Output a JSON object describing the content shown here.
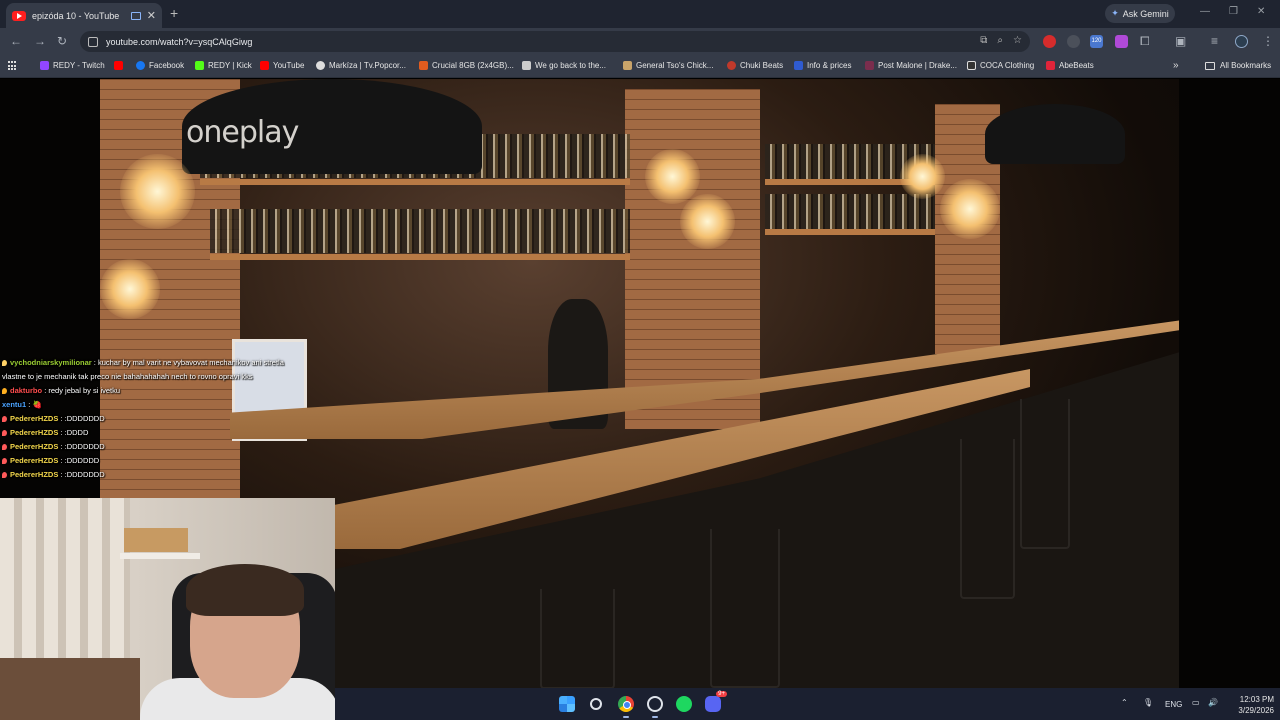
{
  "browser": {
    "tab": {
      "title": "epizóda 10 - YouTube"
    },
    "new_tab_icon": "+",
    "ask_gemini": "Ask Gemini",
    "url": "youtube.com/watch?v=ysqCAlqGiwg",
    "ext_badge": "120",
    "bookmarks": [
      {
        "label": "REDY - Twitch",
        "color": "#9146ff"
      },
      {
        "label": "",
        "color": "#ff0000"
      },
      {
        "label": "Facebook",
        "color": "#1877f2"
      },
      {
        "label": "REDY | Kick",
        "color": "#53fc18"
      },
      {
        "label": "YouTube",
        "color": "#ff0000"
      },
      {
        "label": "Markíza | Tv.Popcor...",
        "color": "#dddddd"
      },
      {
        "label": "Crucial 8GB (2x4GB)...",
        "color": "#e25c1f"
      },
      {
        "label": "We go back to the...",
        "color": "#cccccc"
      },
      {
        "label": "General Tso's Chick...",
        "color": "#c9a46a"
      },
      {
        "label": "Chuki Beats",
        "color": "#c0392b"
      },
      {
        "label": "Info & prices",
        "color": "#2f5bd0"
      },
      {
        "label": "Post Malone | Drake...",
        "color": "#7a2d4d"
      },
      {
        "label": "COCA Clothing",
        "color": "#333333"
      },
      {
        "label": "AbeBeats",
        "color": "#e0243a"
      }
    ],
    "more_bookmarks": "»",
    "all_bookmarks": "All Bookmarks"
  },
  "video": {
    "watermark": "oneplay"
  },
  "chat": [
    {
      "user": "vychodniarskymilionar",
      "user_color": "#9acd32",
      "badge": "#ffd166",
      "message": ": kuchar by mal varit ne vybavovat mechanikov ani stretla"
    },
    {
      "user": "",
      "user_color": "#ffffff",
      "badge": "",
      "message": "vlastne to je mechanik tak preco nie bahahahahah nech to rovno opravi kks"
    },
    {
      "user": "dakturbo",
      "user_color": "#ff4d4d",
      "badge": "#ffb020",
      "message": ": redy jebal by si ivetku"
    },
    {
      "user": "xentu1",
      "user_color": "#4aa3ff",
      "badge": "",
      "message": ": 🍓"
    },
    {
      "user": "PedererHZDS",
      "user_color": "#f2d64b",
      "badge": "#ff5a5a",
      "message": ": :DDDDDDD"
    },
    {
      "user": "PedererHZDS",
      "user_color": "#f2d64b",
      "badge": "#ff5a5a",
      "message": ": :DDDD"
    },
    {
      "user": "PedererHZDS",
      "user_color": "#f2d64b",
      "badge": "#ff5a5a",
      "message": ": :DDDDDDD"
    },
    {
      "user": "PedererHZDS",
      "user_color": "#f2d64b",
      "badge": "#ff5a5a",
      "message": ": :DDDDDD"
    },
    {
      "user": "PedererHZDS",
      "user_color": "#f2d64b",
      "badge": "#ff5a5a",
      "message": ": :DDDDDDD"
    }
  ],
  "taskbar": {
    "language": "ENG",
    "time": "12:03 PM",
    "date": "3/29/2026",
    "discord_badge": "9+"
  }
}
